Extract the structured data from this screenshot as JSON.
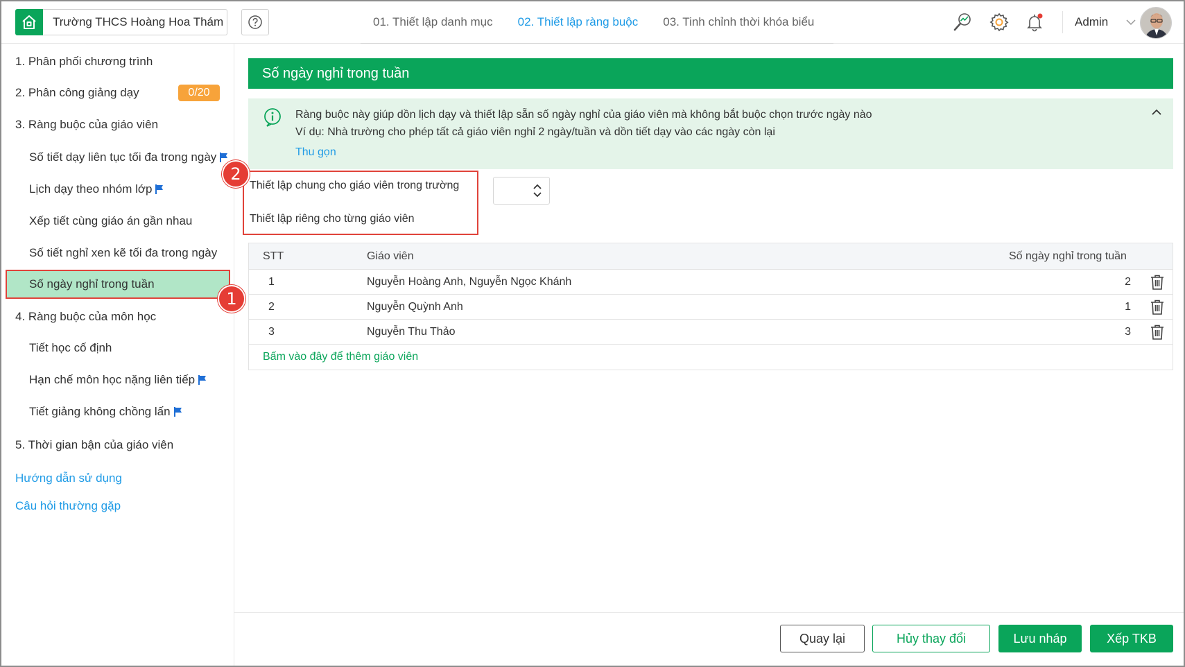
{
  "header": {
    "school_name": "Trường THCS Hoàng Hoa Thám",
    "help_icon": "question-circle-icon",
    "tabs": [
      {
        "label": "01. Thiết lập danh mục"
      },
      {
        "label": "02. Thiết lập ràng buộc"
      },
      {
        "label": "03. Tinh chỉnh thời khóa biểu"
      }
    ],
    "active_tab": 1,
    "user_name": "Admin",
    "notification_dot_color": "#e53d35"
  },
  "sidebar": {
    "items": [
      {
        "label": "1. Phân phối chương trình"
      },
      {
        "label": "2. Phân công giảng dạy",
        "badge": "0/20"
      },
      {
        "label": "3. Ràng buộc của giáo viên"
      },
      {
        "label": "Số tiết dạy liên tục tối đa trong ngày"
      },
      {
        "label": "Lịch dạy theo nhóm lớp"
      },
      {
        "label": "Xếp tiết cùng giáo án gần nhau"
      },
      {
        "label": "Số tiết nghỉ xen kẽ tối đa trong ngày"
      },
      {
        "label": "Số ngày nghỉ trong tuần"
      },
      {
        "label": "4. Ràng buộc của môn học"
      },
      {
        "label": "Tiết học cố định"
      },
      {
        "label": "Hạn chế môn học nặng liên tiếp"
      },
      {
        "label": "Tiết giảng không chồng lấn"
      },
      {
        "label": "5. Thời gian bận của giáo viên"
      }
    ],
    "links": {
      "guide": "Hướng dẫn sử dụng",
      "faq": "Câu hỏi thường gặp"
    }
  },
  "annotations": {
    "step1": "1",
    "step2": "2"
  },
  "main": {
    "title": "Số ngày nghỉ trong tuần",
    "info": {
      "line1": "Ràng buộc này giúp dồn lịch dạy và thiết lập sẵn số ngày nghỉ của giáo viên mà không bắt buộc chọn trước ngày nào",
      "line2": "Ví dụ: Nhà trường cho phép tất cả giáo viên nghỉ 2 ngày/tuần và dồn tiết dạy vào các ngày còn lại",
      "collapse": "Thu gọn"
    },
    "options": {
      "school_wide": "Thiết lập chung cho giáo viên trong trường",
      "per_teacher": "Thiết lập riêng cho từng giáo viên"
    },
    "table": {
      "headers": {
        "stt": "STT",
        "teacher": "Giáo viên",
        "days": "Số ngày nghỉ trong tuần"
      },
      "rows": [
        {
          "stt": "1",
          "teacher": "Nguyễn Hoàng Anh, Nguyễn Ngọc Khánh",
          "days": "2"
        },
        {
          "stt": "2",
          "teacher": "Nguyễn Quỳnh Anh",
          "days": "1"
        },
        {
          "stt": "3",
          "teacher": "Nguyễn Thu Thảo",
          "days": "3"
        }
      ],
      "add_link": "Bấm vào đây để thêm giáo viên"
    },
    "buttons": {
      "back": "Quay lại",
      "cancel": "Hủy thay đổi",
      "draft": "Lưu nháp",
      "build": "Xếp TKB"
    }
  },
  "colors": {
    "primary_green": "#0aa55a",
    "link_blue": "#1f9be6",
    "badge_orange": "#f7a33a",
    "highlight_red": "#e0433a",
    "selected_bg": "#b1e6c7",
    "info_bg": "#e4f4e9"
  }
}
